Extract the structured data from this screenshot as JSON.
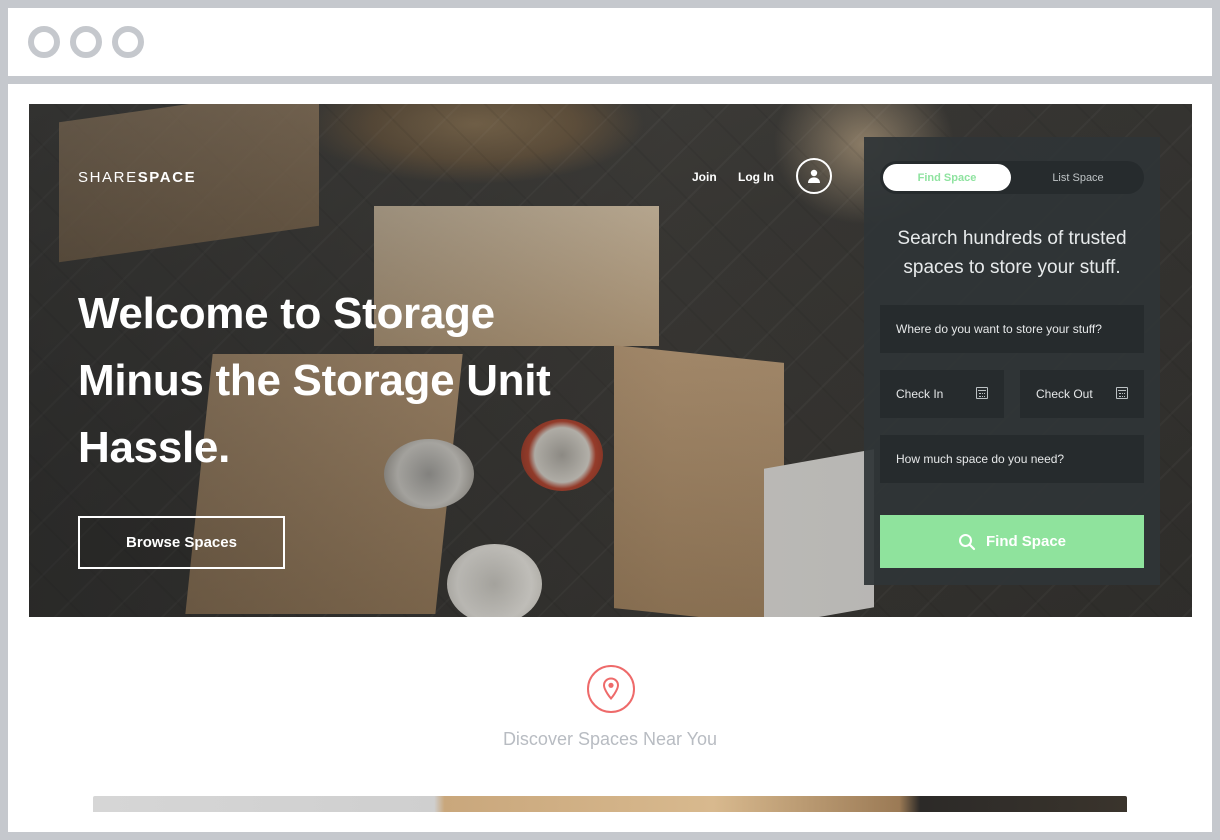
{
  "brand": {
    "name_light": "SHARE",
    "name_bold": "SPACE"
  },
  "nav": {
    "join": "Join",
    "login": "Log In"
  },
  "hero": {
    "title": "Welcome to Storage Minus the Storage Unit Hassle.",
    "browse_button": "Browse Spaces"
  },
  "search_panel": {
    "tabs": [
      {
        "label": "Find Space",
        "active": true
      },
      {
        "label": "List Space",
        "active": false
      }
    ],
    "heading": "Search hundreds of trusted spaces to store your stuff.",
    "location_placeholder": "Where do you want to store your stuff?",
    "check_in": "Check In",
    "check_out": "Check Out",
    "size_placeholder": "How much space do you need?",
    "submit": "Find Space"
  },
  "discover": {
    "label": "Discover Spaces Near You"
  },
  "colors": {
    "accent_green": "#8fe39d",
    "pin_red": "#ee6a6a",
    "panel_bg": "#2f3537"
  }
}
